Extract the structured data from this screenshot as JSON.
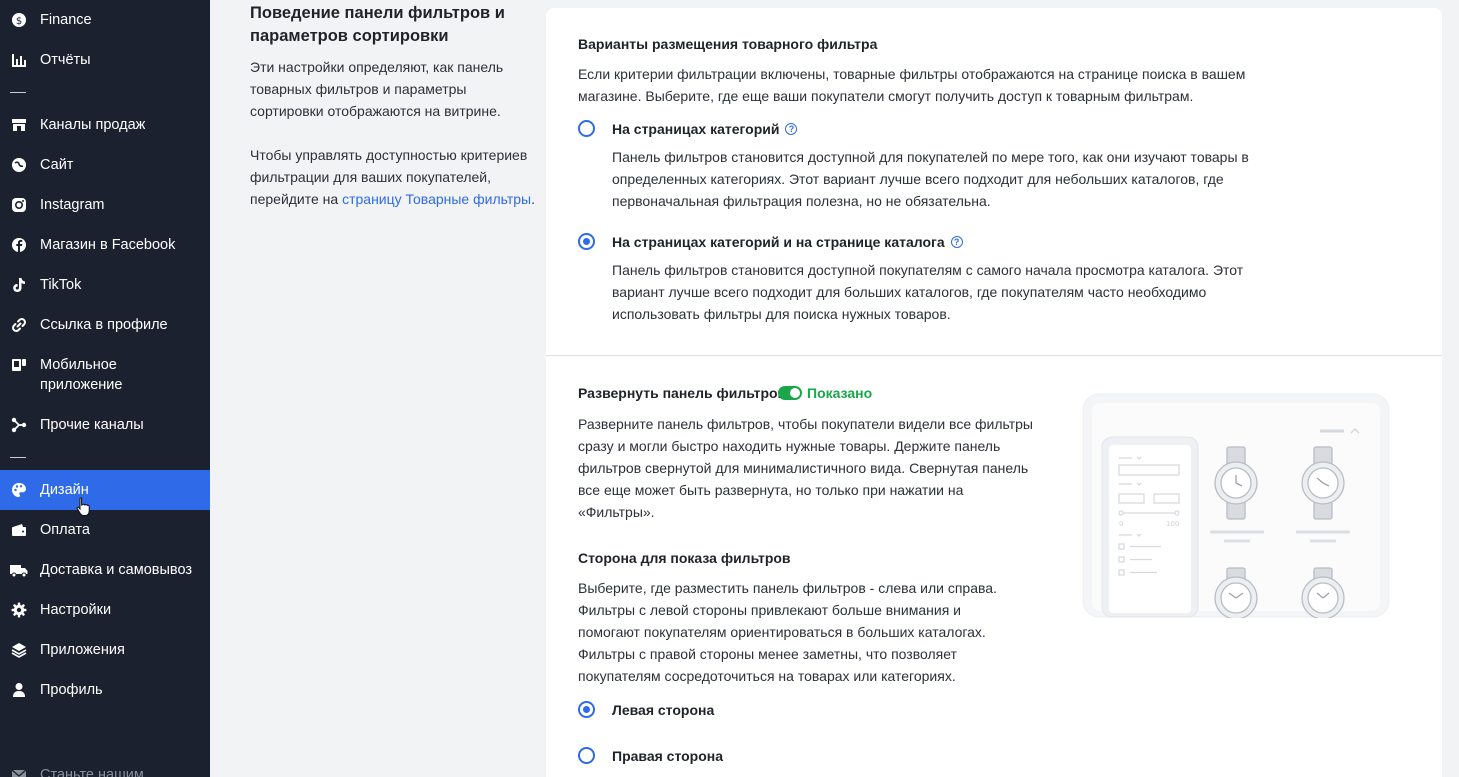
{
  "sidebar": {
    "items": [
      {
        "label": "Finance",
        "icon": "finance-icon"
      },
      {
        "label": "Отчёты",
        "icon": "reports-icon"
      },
      {
        "label": "Каналы продаж",
        "icon": "sales-channels-icon"
      },
      {
        "label": "Сайт",
        "icon": "site-icon"
      },
      {
        "label": "Instagram",
        "icon": "instagram-icon"
      },
      {
        "label": "Магазин в Facebook",
        "icon": "facebook-icon"
      },
      {
        "label": "TikTok",
        "icon": "tiktok-icon"
      },
      {
        "label": "Ссылка в профиле",
        "icon": "link-icon"
      },
      {
        "label": "Мобильное приложение",
        "icon": "mobile-app-icon"
      },
      {
        "label": "Прочие каналы",
        "icon": "other-channels-icon"
      },
      {
        "label": "Дизайн",
        "icon": "palette-icon",
        "active": true
      },
      {
        "label": "Оплата",
        "icon": "wallet-icon"
      },
      {
        "label": "Доставка и самовывоз",
        "icon": "truck-icon"
      },
      {
        "label": "Настройки",
        "icon": "gear-icon"
      },
      {
        "label": "Приложения",
        "icon": "layers-icon"
      },
      {
        "label": "Профиль",
        "icon": "person-icon"
      },
      {
        "label": "Станьте нашим...",
        "icon": "mail-icon"
      }
    ]
  },
  "description": {
    "title": "Поведение панели фильтров и параметров сортировки",
    "p1": "Эти настройки определяют, как панель товарных фильтров и параметры сортировки отображаются на витрине.",
    "p2_prefix": "Чтобы управлять доступностью критериев фильтрации для ваших покупателей, перейдите на ",
    "p2_link": "страницу Товарные фильтры",
    "p2_suffix": "."
  },
  "placement": {
    "title": "Варианты размещения товарного фильтра",
    "text": "Если критерии фильтрации включены, товарные фильтры отображаются на странице поиска в вашем магазине. Выберите, где еще ваши покупатели смогут получить доступ к товарным фильтрам.",
    "options": [
      {
        "label": "На страницах категорий",
        "help": "?",
        "selected": false,
        "text": "Панель фильтров становится доступной для покупателей по мере того, как они изучают товары в определенных категориях. Этот вариант лучше всего подходит для небольших каталогов, где первоначальная фильтрация полезна, но не обязательна."
      },
      {
        "label": "На страницах категорий и на странице каталога",
        "help": "?",
        "selected": true,
        "text": "Панель фильтров становится доступной покупателям с самого начала просмотра каталога. Этот вариант лучше всего подходит для больших каталогов, где покупателям часто необходимо использовать фильтры для поиска нужных товаров."
      }
    ]
  },
  "expand": {
    "title": "Развернуть панель фильтров",
    "toggle_on": true,
    "toggle_label": "Показано",
    "text": "Разверните панель фильтров, чтобы покупатели видели все фильтры сразу и могли быстро находить нужные товары. Держите панель фильтров свернутой для минималистичного вида. Свернутая панель все еще может быть развернута, но только при нажатии на «Фильтры»."
  },
  "side": {
    "title": "Сторона для показа фильтров",
    "text": "Выберите, где разместить панель фильтров - слева или справа. Фильтры с левой стороны привлекают больше внимания и помогают покупателям ориентироваться в больших каталогах. Фильтры с правой стороны менее заметны, что позволяет покупателям сосредоточиться на товарах или категориях.",
    "options": [
      {
        "label": "Левая сторона",
        "selected": true
      },
      {
        "label": "Правая сторона",
        "selected": false
      }
    ]
  },
  "illustration": {
    "range_min": "0",
    "range_max": "100"
  },
  "colors": {
    "sidebar_bg": "#1c2130",
    "accent": "#2f6ae8",
    "success": "#19a74a"
  }
}
